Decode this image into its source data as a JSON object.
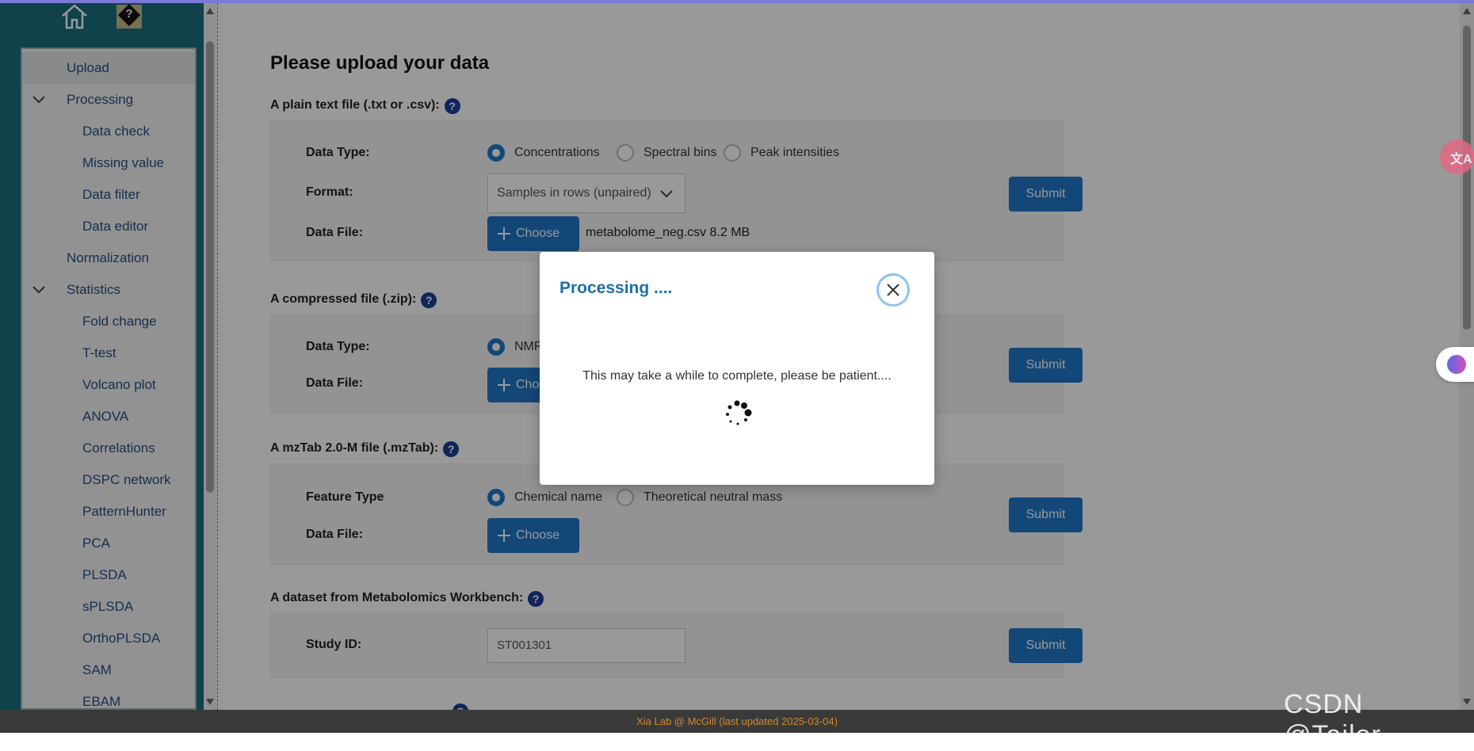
{
  "sidebar": {
    "items": [
      {
        "label": "Upload",
        "level": 1,
        "active": true
      },
      {
        "label": "Processing",
        "level": 1,
        "expanded": true
      },
      {
        "label": "Data check",
        "level": 2
      },
      {
        "label": "Missing value",
        "level": 2
      },
      {
        "label": "Data filter",
        "level": 2
      },
      {
        "label": "Data editor",
        "level": 2
      },
      {
        "label": "Normalization",
        "level": 1
      },
      {
        "label": "Statistics",
        "level": 1,
        "expanded": true
      },
      {
        "label": "Fold change",
        "level": 2
      },
      {
        "label": "T-test",
        "level": 2
      },
      {
        "label": "Volcano plot",
        "level": 2
      },
      {
        "label": "ANOVA",
        "level": 2
      },
      {
        "label": "Correlations",
        "level": 2
      },
      {
        "label": "DSPC network",
        "level": 2
      },
      {
        "label": "PatternHunter",
        "level": 2
      },
      {
        "label": "PCA",
        "level": 2
      },
      {
        "label": "PLSDA",
        "level": 2
      },
      {
        "label": "sPLSDA",
        "level": 2
      },
      {
        "label": "OrthoPLSDA",
        "level": 2
      },
      {
        "label": "SAM",
        "level": 2
      },
      {
        "label": "EBAM",
        "level": 2
      }
    ]
  },
  "main": {
    "title": "Please upload your data",
    "plain": {
      "title": "A plain text file (.txt or .csv):",
      "data_type_label": "Data Type:",
      "options": [
        "Concentrations",
        "Spectral bins",
        "Peak intensities"
      ],
      "format_label": "Format:",
      "format_value": "Samples in rows (unpaired)",
      "data_file_label": "Data File:",
      "choose": "Choose",
      "file_info": "metabolome_neg.csv 8.2 MB",
      "submit": "Submit"
    },
    "compressed": {
      "title": "A compressed file (.zip):",
      "data_type_label": "Data Type:",
      "option": "NMR",
      "data_file_label": "Data File:",
      "choose": "Choose",
      "submit": "Submit"
    },
    "mztab": {
      "title": "A mzTab 2.0-M file (.mzTab):",
      "feature_label": "Feature Type",
      "options": [
        "Chemical name",
        "Theoretical neutral mass"
      ],
      "data_file_label": "Data File:",
      "choose": "Choose",
      "submit": "Submit"
    },
    "workbench": {
      "title": "A dataset from Metabolomics Workbench:",
      "study_label": "Study ID:",
      "placeholder": "ST001301",
      "submit": "Submit"
    }
  },
  "dialog": {
    "title": "Processing ....",
    "message": "This may take a while to complete, please be patient...."
  },
  "footer": {
    "text": "Xia Lab @ McGill   (last updated 2025-03-04)"
  },
  "watermark": "CSDN @Tailor.",
  "colors": {
    "accent": "#1e77c8",
    "sidebar": "#1a6e7e",
    "dialog_title": "#1e6ea8",
    "footer_text": "#d08a2d"
  }
}
